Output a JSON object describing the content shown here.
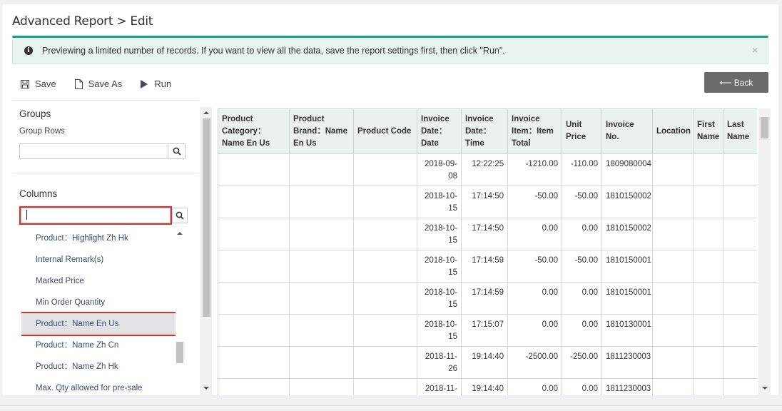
{
  "page": {
    "title": "Advanced Report > Edit"
  },
  "alert": {
    "message": "Previewing a limited number of records. If you want to view all the data, save the report settings first, then click \"Run\"."
  },
  "toolbar": {
    "save_label": "Save",
    "save_as_label": "Save As",
    "run_label": "Run",
    "back_label": "Back"
  },
  "groups": {
    "title": "Groups",
    "subtitle": "Group Rows",
    "search_value": ""
  },
  "columns": {
    "title": "Columns",
    "search_value": "",
    "items": [
      "Product：Highlight Zh Hk",
      "Internal Remark(s)",
      "Marked Price",
      "Min Order Quantity",
      "Product：Name En Us",
      "Product：Name Zh Cn",
      "Product：Name Zh Hk",
      "Max. Qty allowed for pre-sale"
    ],
    "selected_index": 4
  },
  "table": {
    "headers": [
      "Product Category：Name En Us",
      "Product Brand：Name En Us",
      "Product Code",
      "Invoice Date：Date",
      "Invoice Date：Time",
      "Invoice Item：Item Total",
      "Unit Price",
      "Invoice No.",
      "Location",
      "First Name",
      "Last Name"
    ],
    "rows": [
      [
        "",
        "",
        "",
        "2018-09-08",
        "12:22:25",
        "-1210.00",
        "-110.00",
        "1809080004",
        "",
        "",
        ""
      ],
      [
        "",
        "",
        "",
        "2018-10-15",
        "17:14:50",
        "-50.00",
        "-50.00",
        "1810150002",
        "",
        "",
        ""
      ],
      [
        "",
        "",
        "",
        "2018-10-15",
        "17:14:50",
        "0.00",
        "0.00",
        "1810150002",
        "",
        "",
        ""
      ],
      [
        "",
        "",
        "",
        "2018-10-15",
        "17:14:59",
        "-50.00",
        "-50.00",
        "1810150001",
        "",
        "",
        ""
      ],
      [
        "",
        "",
        "",
        "2018-10-15",
        "17:14:59",
        "0.00",
        "0.00",
        "1810150001",
        "",
        "",
        ""
      ],
      [
        "",
        "",
        "",
        "2018-10-15",
        "17:15:07",
        "0.00",
        "0.00",
        "1810130001",
        "",
        "",
        ""
      ],
      [
        "",
        "",
        "",
        "2018-11-26",
        "19:14:40",
        "-2500.00",
        "-250.00",
        "1811230003",
        "",
        "",
        ""
      ],
      [
        "",
        "",
        "",
        "2018-11-",
        "19:14:40",
        "0.00",
        "0.00",
        "1811230003",
        "",
        "",
        ""
      ]
    ]
  },
  "colors": {
    "accent": "#14a085",
    "highlight": "#d9342b",
    "back_button": "#6b6b6b"
  }
}
